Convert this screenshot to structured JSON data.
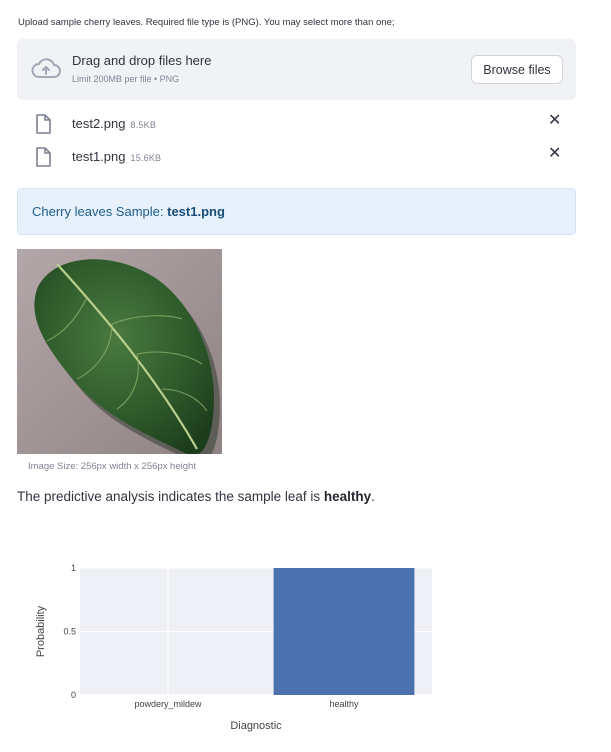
{
  "uploader": {
    "label": "Upload sample cherry leaves. Required file type is (PNG). You may select more than one;",
    "drop_title": "Drag and drop files here",
    "drop_subtitle": "Limit 200MB per file • PNG",
    "browse_label": "Browse files"
  },
  "files": [
    {
      "name": "test2.png",
      "size": "8.5KB",
      "close": "✕"
    },
    {
      "name": "test1.png",
      "size": "15.6KB",
      "close": "✕"
    }
  ],
  "sample_info": {
    "prefix": "Cherry leaves Sample: ",
    "filename": "test1.png"
  },
  "image": {
    "caption": "Image Size: 256px width x 256px height"
  },
  "result": {
    "prefix": "The predictive analysis indicates the sample leaf is ",
    "label": "healthy",
    "suffix": "."
  },
  "colors": {
    "bar": "#4c72b0",
    "plot_bg": "#eff0f5",
    "info_bg": "#e6f1fc",
    "dropzone_bg": "#f0f2f6"
  },
  "chart_data": {
    "type": "bar",
    "categories": [
      "powdery_mildew",
      "healthy"
    ],
    "values": [
      0.0,
      1.0
    ],
    "title": "",
    "xlabel": "Diagnostic",
    "ylabel": "Probability",
    "ylim": [
      0,
      1
    ],
    "yticks": [
      "0",
      "0.5",
      "1"
    ],
    "grid": true,
    "legend": "none"
  }
}
